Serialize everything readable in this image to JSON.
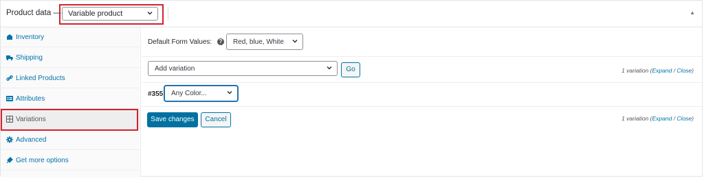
{
  "header": {
    "title": "Product data —",
    "product_type": "Variable product"
  },
  "sidebar": {
    "items": [
      {
        "label": "Inventory",
        "icon": "inventory-icon"
      },
      {
        "label": "Shipping",
        "icon": "truck-icon"
      },
      {
        "label": "Linked Products",
        "icon": "link-icon"
      },
      {
        "label": "Attributes",
        "icon": "list-icon"
      },
      {
        "label": "Variations",
        "icon": "grid-icon",
        "active": true
      },
      {
        "label": "Advanced",
        "icon": "gear-icon"
      },
      {
        "label": "Get more options",
        "icon": "plugin-icon"
      }
    ]
  },
  "defaults": {
    "label": "Default Form Values:",
    "value": "Red, blue, White"
  },
  "add_variation": {
    "value": "Add variation",
    "go_label": "Go"
  },
  "variation_count": {
    "text": "1 variation (",
    "expand": "Expand",
    "sep": " / ",
    "close": "Close",
    "end": ")"
  },
  "variation": {
    "id": "#355",
    "color_value": "Any Color..."
  },
  "actions": {
    "save_label": "Save changes",
    "cancel_label": "Cancel"
  },
  "colors": {
    "accent": "#0071a1",
    "highlight": "#d2222d"
  }
}
